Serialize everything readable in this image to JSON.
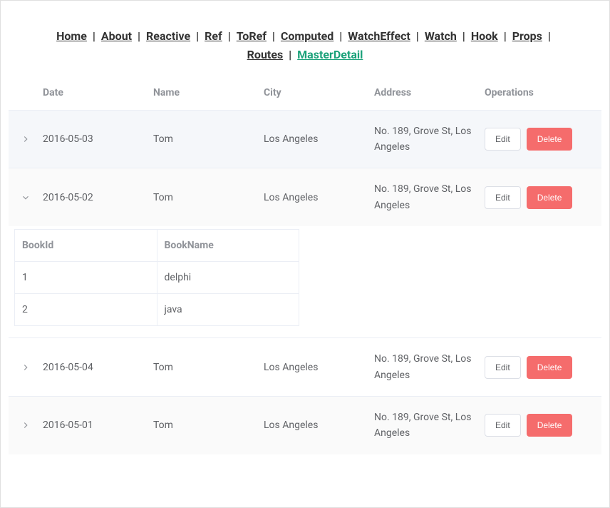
{
  "nav": {
    "items": [
      {
        "label": "Home",
        "active": false
      },
      {
        "label": "About",
        "active": false
      },
      {
        "label": "Reactive",
        "active": false
      },
      {
        "label": "Ref",
        "active": false
      },
      {
        "label": "ToRef",
        "active": false
      },
      {
        "label": "Computed",
        "active": false
      },
      {
        "label": "WatchEffect",
        "active": false
      },
      {
        "label": "Watch",
        "active": false
      },
      {
        "label": "Hook",
        "active": false
      },
      {
        "label": "Props",
        "active": false
      },
      {
        "label": "Routes",
        "active": false
      },
      {
        "label": "MasterDetail",
        "active": true
      }
    ],
    "separator": "|"
  },
  "table": {
    "columns": {
      "date": "Date",
      "name": "Name",
      "city": "City",
      "address": "Address",
      "operations": "Operations"
    },
    "ops": {
      "edit": "Edit",
      "delete": "Delete"
    },
    "rows": [
      {
        "date": "2016-05-03",
        "name": "Tom",
        "city": "Los Angeles",
        "address": "No. 189, Grove St, Los Angeles",
        "expanded": false,
        "hovered": true
      },
      {
        "date": "2016-05-02",
        "name": "Tom",
        "city": "Los Angeles",
        "address": "No. 189, Grove St, Los Angeles",
        "expanded": true,
        "detail": {
          "columns": {
            "bookId": "BookId",
            "bookName": "BookName"
          },
          "rows": [
            {
              "bookId": "1",
              "bookName": "delphi"
            },
            {
              "bookId": "2",
              "bookName": "java"
            }
          ]
        }
      },
      {
        "date": "2016-05-04",
        "name": "Tom",
        "city": "Los Angeles",
        "address": "No. 189, Grove St, Los Angeles",
        "expanded": false
      },
      {
        "date": "2016-05-01",
        "name": "Tom",
        "city": "Los Angeles",
        "address": "No. 189, Grove St, Los Angeles",
        "expanded": false
      }
    ]
  }
}
